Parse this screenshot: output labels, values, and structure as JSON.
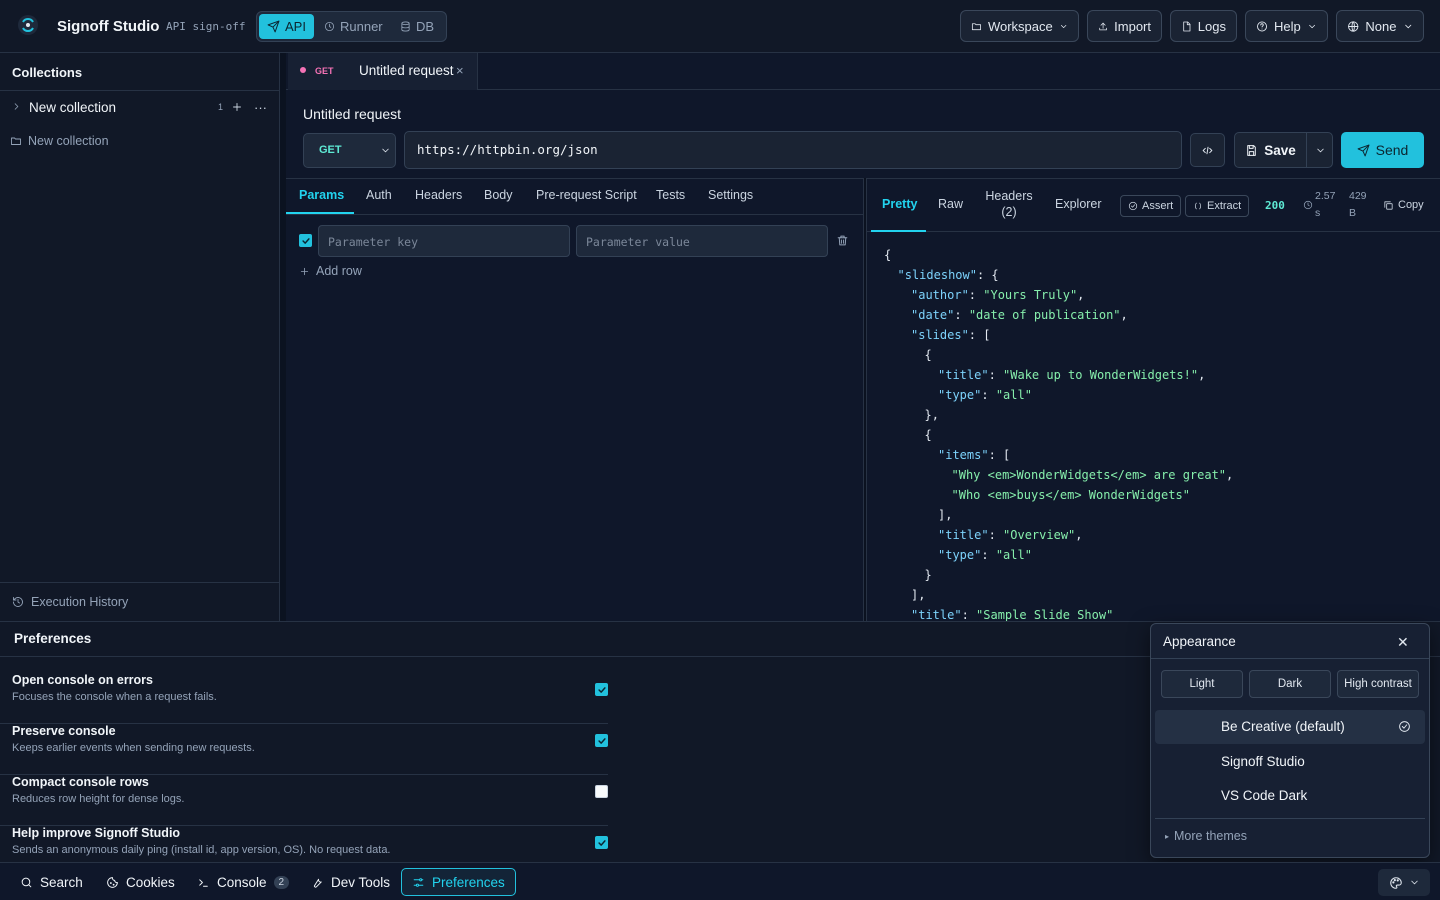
{
  "app": {
    "name": "Signoff Studio",
    "subtitle": "API sign-off"
  },
  "modes": [
    {
      "label": "API",
      "icon": "send-icon",
      "active": true
    },
    {
      "label": "Runner",
      "icon": "runner-icon",
      "active": false
    },
    {
      "label": "DB",
      "icon": "database-icon",
      "active": false
    }
  ],
  "topbar": {
    "workspace": "Workspace",
    "import": "Import",
    "logs": "Logs",
    "help": "Help",
    "env": "None"
  },
  "sidebar": {
    "title": "Collections",
    "collection": {
      "name": "New collection",
      "count": "1"
    },
    "subitem": "New collection",
    "execution_history": "Execution History"
  },
  "tab": {
    "method": "GET",
    "title": "Untitled request"
  },
  "request": {
    "title": "Untitled request",
    "method": "GET",
    "url": "https://httpbin.org/json",
    "save_label": "Save",
    "send_label": "Send"
  },
  "param_tabs": [
    "Params",
    "Auth",
    "Headers",
    "Body",
    "Pre-request Script",
    "Tests",
    "Settings"
  ],
  "params": {
    "key_placeholder": "Parameter key",
    "value_placeholder": "Parameter value",
    "add_row": "Add row"
  },
  "response": {
    "tabs": {
      "pretty": "Pretty",
      "raw": "Raw",
      "headers": "Headers",
      "headers_count": "(2)",
      "explorer": "Explorer"
    },
    "assert": "Assert",
    "extract": "Extract",
    "status": "200",
    "time_value": "2.57",
    "time_unit": "s",
    "size_value": "429",
    "size_unit": "B",
    "copy": "Copy",
    "json_lines": [
      {
        "indent": 0,
        "key": "",
        "value": "",
        "post": "{"
      },
      {
        "indent": 1,
        "key": "\"slideshow\"",
        "value": "",
        "post": ": {"
      },
      {
        "indent": 2,
        "key": "\"author\"",
        "value": "\"Yours Truly\"",
        "post": ","
      },
      {
        "indent": 2,
        "key": "\"date\"",
        "value": "\"date of publication\"",
        "post": ","
      },
      {
        "indent": 2,
        "key": "\"slides\"",
        "value": "",
        "post": ": ["
      },
      {
        "indent": 3,
        "key": "",
        "value": "",
        "post": "{"
      },
      {
        "indent": 4,
        "key": "\"title\"",
        "value": "\"Wake up to WonderWidgets!\"",
        "post": ","
      },
      {
        "indent": 4,
        "key": "\"type\"",
        "value": "\"all\"",
        "post": ""
      },
      {
        "indent": 3,
        "key": "",
        "value": "",
        "post": "},"
      },
      {
        "indent": 3,
        "key": "",
        "value": "",
        "post": "{"
      },
      {
        "indent": 4,
        "key": "\"items\"",
        "value": "",
        "post": ": ["
      },
      {
        "indent": 5,
        "key": "",
        "value": "\"Why <em>WonderWidgets</em> are great\"",
        "post": ","
      },
      {
        "indent": 5,
        "key": "",
        "value": "\"Who <em>buys</em> WonderWidgets\"",
        "post": ""
      },
      {
        "indent": 4,
        "key": "",
        "value": "",
        "post": "],"
      },
      {
        "indent": 4,
        "key": "\"title\"",
        "value": "\"Overview\"",
        "post": ","
      },
      {
        "indent": 4,
        "key": "\"type\"",
        "value": "\"all\"",
        "post": ""
      },
      {
        "indent": 3,
        "key": "",
        "value": "",
        "post": "}"
      },
      {
        "indent": 2,
        "key": "",
        "value": "",
        "post": "],"
      },
      {
        "indent": 2,
        "key": "\"title\"",
        "value": "\"Sample Slide Show\"",
        "post": ""
      }
    ]
  },
  "preferences": {
    "title": "Preferences",
    "items": [
      {
        "title": "Open console on errors",
        "desc": "Focuses the console when a request fails.",
        "checked": true
      },
      {
        "title": "Preserve console",
        "desc": "Keeps earlier events when sending new requests.",
        "checked": true
      },
      {
        "title": "Compact console rows",
        "desc": "Reduces row height for dense logs.",
        "checked": false
      },
      {
        "title": "Help improve Signoff Studio",
        "desc": "Sends an anonymous daily ping (install id, app version, OS). No request data.",
        "checked": true
      }
    ]
  },
  "appearance": {
    "title": "Appearance",
    "modes": [
      "Light",
      "Dark",
      "High contrast"
    ],
    "themes": [
      {
        "name": "Be Creative (default)",
        "selected": true
      },
      {
        "name": "Signoff Studio",
        "selected": false
      },
      {
        "name": "VS Code Dark",
        "selected": false
      }
    ],
    "more": "More themes"
  },
  "bottombar": {
    "search": "Search",
    "cookies": "Cookies",
    "console": "Console",
    "console_count": "2",
    "devtools": "Dev Tools",
    "preferences": "Preferences"
  },
  "colors": {
    "accent": "#22c1dd",
    "background": "#0f172a",
    "json_key": "#7dd3fc",
    "json_string": "#86efac",
    "method_get": "#f472b6"
  }
}
